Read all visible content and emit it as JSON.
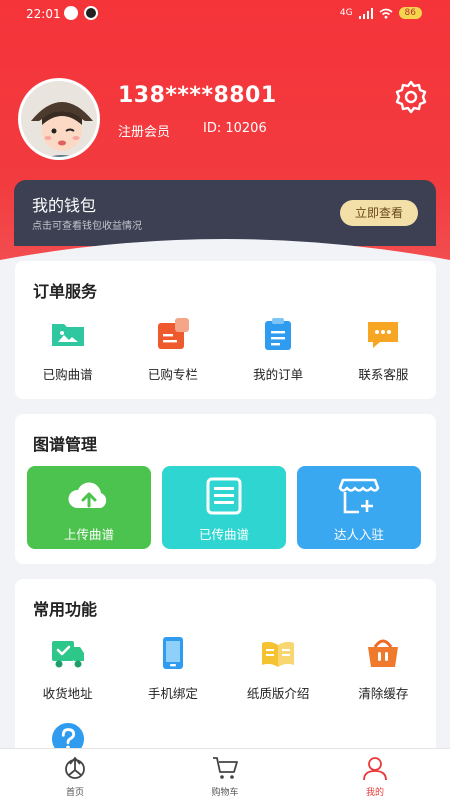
{
  "status_bar": {
    "time": "22:01",
    "network": "4G",
    "battery": "86"
  },
  "profile": {
    "username": "138****8801",
    "member": "注册会员",
    "member_id": "ID: 10206"
  },
  "wallet": {
    "title": "我的钱包",
    "subtitle": "点击可查看钱包收益情况",
    "button": "立即查看"
  },
  "orders": {
    "title": "订单服务",
    "items": [
      {
        "label": "已购曲谱",
        "icon": "folder-icon"
      },
      {
        "label": "已购专栏",
        "icon": "column-icon"
      },
      {
        "label": "我的订单",
        "icon": "clipboard-icon"
      },
      {
        "label": "联系客服",
        "icon": "chat-icon"
      }
    ]
  },
  "sheets": {
    "title": "图谱管理",
    "items": [
      {
        "label": "上传曲谱",
        "icon": "cloud-upload-icon",
        "color": "#4cc24f"
      },
      {
        "label": "已传曲谱",
        "icon": "list-icon",
        "color": "#2fd5d0"
      },
      {
        "label": "达人入驻",
        "icon": "shop-icon",
        "color": "#3aa8f0"
      }
    ]
  },
  "common": {
    "title": "常用功能",
    "items": [
      {
        "label": "收货地址",
        "icon": "truck-icon"
      },
      {
        "label": "手机绑定",
        "icon": "phone-icon"
      },
      {
        "label": "纸质版介绍",
        "icon": "book-icon"
      },
      {
        "label": "清除缓存",
        "icon": "basket-icon"
      }
    ],
    "extra_icon": "help-icon"
  },
  "tabbar": {
    "items": [
      {
        "label": "首页",
        "icon": "home-icon"
      },
      {
        "label": "购物车",
        "icon": "cart-icon"
      },
      {
        "label": "我的",
        "icon": "user-icon",
        "active": true
      }
    ]
  },
  "colors": {
    "header": "#f5343a",
    "wallet": "#3c4052",
    "accent": "#e83a3a"
  }
}
